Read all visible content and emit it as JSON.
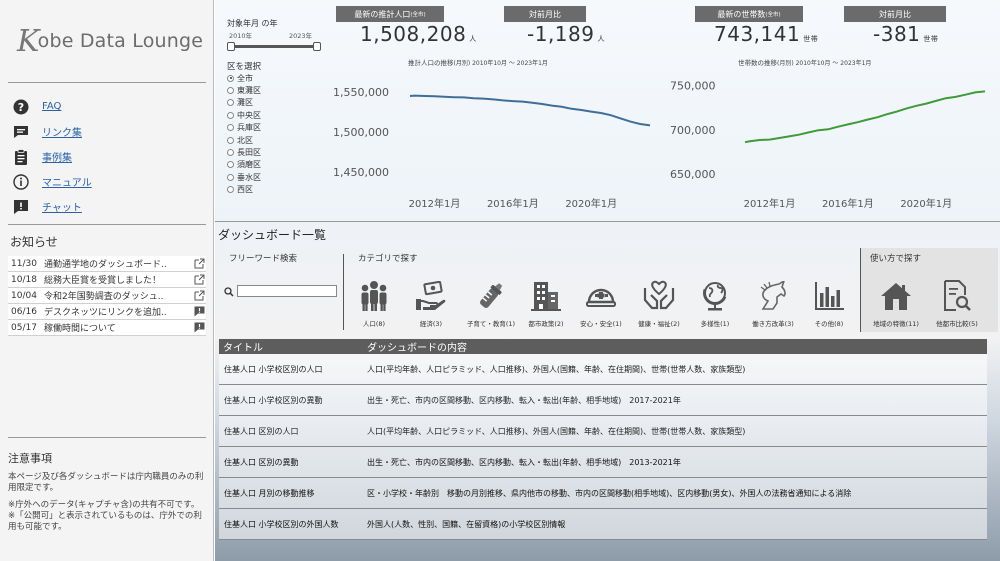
{
  "brand": {
    "logo_k": "K",
    "logo_rest": "obe Data Lounge"
  },
  "nav": [
    {
      "label": "FAQ",
      "icon": "question-circle-icon"
    },
    {
      "label": "リンク集",
      "icon": "chat-bubble-icon"
    },
    {
      "label": "事例集",
      "icon": "clipboard-icon"
    },
    {
      "label": "マニュアル",
      "icon": "info-circle-icon"
    },
    {
      "label": "チャット",
      "icon": "exclamation-bubble-icon"
    }
  ],
  "notices": {
    "title": "お知らせ",
    "items": [
      {
        "date": "11/30",
        "text": "通勤通学地のダッシュボード..",
        "icon": "external-link-icon"
      },
      {
        "date": "10/18",
        "text": "総務大臣賞を受賞しました！",
        "icon": "external-link-icon"
      },
      {
        "date": "10/04",
        "text": "令和2年国勢調査のダッシュ..",
        "icon": "external-link-icon"
      },
      {
        "date": "06/16",
        "text": "デスクネッツにリンクを追加..",
        "icon": "exclamation-bubble-icon"
      },
      {
        "date": "05/17",
        "text": "稼働時間について",
        "icon": "exclamation-bubble-icon"
      }
    ]
  },
  "caution": {
    "title": "注意事項",
    "paragraphs": [
      "本ページ及び各ダッシュボードは庁内職員のみの利用限定です。",
      "※庁外へのデータ(キャプチャ含)の共有不可です。",
      "※「公開可」と表示されているものは、庁外での利用も可能です。"
    ]
  },
  "filters": {
    "year_title": "対象年月 の年",
    "year_from": "2010年",
    "year_to": "2023年",
    "year_range": [
      0,
      1
    ],
    "ward_title": "区を選択",
    "wards": [
      "全市",
      "東灘区",
      "灘区",
      "中央区",
      "兵庫区",
      "北区",
      "長田区",
      "須磨区",
      "垂水区",
      "西区"
    ],
    "selected_ward": "全市"
  },
  "kpis": {
    "population": {
      "label": "最新の推計人口",
      "label_small": "(全市)",
      "value": "1,508,208",
      "unit": "人"
    },
    "population_diff": {
      "label": "対前月比",
      "value": "-1,189",
      "unit": "人"
    },
    "households": {
      "label": "最新の世帯数",
      "label_small": "(全市)",
      "value": "743,141",
      "unit": "世帯"
    },
    "households_diff": {
      "label": "対前月比",
      "value": "-381",
      "unit": "世帯"
    }
  },
  "chart_data": [
    {
      "type": "line",
      "title": "推計人口の推移",
      "subtitle": "(月別) 2010年10月 ～ 2023年1月",
      "x_ticks": [
        "2012年1月",
        "2016年1月",
        "2020年1月"
      ],
      "y_ticks": [
        "1,550,000",
        "1,500,000",
        "1,450,000"
      ],
      "ylim": [
        1425000,
        1575000
      ],
      "xlim": [
        2010.75,
        2023.0
      ],
      "color": "#3f6e99",
      "x": [
        2010.75,
        2011.0,
        2011.5,
        2012.0,
        2012.5,
        2013.0,
        2013.5,
        2014.0,
        2014.5,
        2015.0,
        2015.5,
        2016.0,
        2016.5,
        2017.0,
        2017.5,
        2018.0,
        2018.5,
        2019.0,
        2019.5,
        2020.0,
        2020.5,
        2021.0,
        2021.5,
        2022.0,
        2022.5,
        2023.0
      ],
      "y": [
        1545000,
        1545500,
        1545000,
        1544800,
        1544000,
        1543500,
        1543200,
        1542200,
        1541800,
        1540800,
        1539500,
        1538600,
        1538000,
        1536500,
        1535000,
        1533000,
        1531500,
        1529000,
        1527500,
        1525500,
        1523800,
        1521000,
        1517000,
        1513000,
        1510000,
        1508208
      ]
    },
    {
      "type": "line",
      "title": "世帯数の推移",
      "subtitle": "(月別) 2010年10月 ～ 2023年1月",
      "x_ticks": [
        "2012年1月",
        "2016年1月",
        "2020年1月"
      ],
      "y_ticks": [
        "750,000",
        "700,000",
        "650,000"
      ],
      "ylim": [
        630000,
        765000
      ],
      "xlim": [
        2010.75,
        2023.0
      ],
      "color": "#3f9a3a",
      "x": [
        2010.75,
        2011.0,
        2011.5,
        2012.0,
        2012.5,
        2013.0,
        2013.5,
        2014.0,
        2014.5,
        2015.0,
        2015.5,
        2016.0,
        2016.5,
        2017.0,
        2017.5,
        2018.0,
        2018.5,
        2019.0,
        2019.5,
        2020.0,
        2020.5,
        2021.0,
        2021.5,
        2022.0,
        2022.5,
        2023.0
      ],
      "y": [
        686000,
        687000,
        688500,
        689000,
        690800,
        692500,
        694500,
        697000,
        699500,
        700500,
        703500,
        706000,
        708500,
        711500,
        714000,
        717500,
        720500,
        724000,
        727000,
        729500,
        732500,
        735500,
        737000,
        739500,
        742000,
        743141
      ]
    }
  ],
  "dashboard": {
    "title": "ダッシュボード一覧",
    "free_word": "フリーワード検索",
    "search_placeholder": "",
    "category_title": "カテゴリで探す",
    "use_title": "使い方で探す",
    "categories": [
      {
        "label": "人口(8)",
        "icon": "people-icon"
      },
      {
        "label": "経済(3)",
        "icon": "money-hand-icon"
      },
      {
        "label": "子育て・教育(1)",
        "icon": "baby-bottle-icon"
      },
      {
        "label": "都市政策(2)",
        "icon": "buildings-icon"
      },
      {
        "label": "安心・安全(1)",
        "icon": "helmet-icon"
      },
      {
        "label": "健康・福祉(2)",
        "icon": "heart-hands-icon"
      },
      {
        "label": "多様性(1)",
        "icon": "globe-icon"
      },
      {
        "label": "働き方改革(3)",
        "icon": "unicorn-icon"
      },
      {
        "label": "その他(8)",
        "icon": "bar-chart-icon"
      }
    ],
    "uses": [
      {
        "label": "地域の特徴(11)",
        "icon": "house-icon"
      },
      {
        "label": "他都市比較(5)",
        "icon": "document-search-icon"
      }
    ],
    "table": {
      "headers": [
        "タイトル",
        "ダッシュボードの内容"
      ],
      "rows": [
        [
          "住基人口 小学校区別の人口",
          "人口(平均年齢、人口ピラミッド、人口推移)、外国人(国籍、年齢、在住期間)、世帯(世帯人数、家族類型)"
        ],
        [
          "住基人口 小学校区別の異動",
          "出生・死亡、市内の区間移動、区内移動、転入・転出(年齢、相手地域)　2017-2021年"
        ],
        [
          "住基人口 区別の人口",
          "人口(平均年齢、人口ピラミッド、人口推移)、外国人(国籍、年齢、在住期間)、世帯(世帯人数、家族類型)"
        ],
        [
          "住基人口 区別の異動",
          "出生・死亡、市内の区間移動、区内移動、転入・転出(年齢、相手地域)　2013-2021年"
        ],
        [
          "住基人口 月別の移動推移",
          "区・小学校・年齢別　移動の月別推移、県内他市の移動、市内の区間移動(相手地域)、区内移動(男女)、外国人の法務省通知による消除"
        ],
        [
          "住基人口 小学校区別の外国人数",
          "外国人(人数、性別、国籍、在留資格)の小学校区別情報"
        ]
      ]
    }
  }
}
